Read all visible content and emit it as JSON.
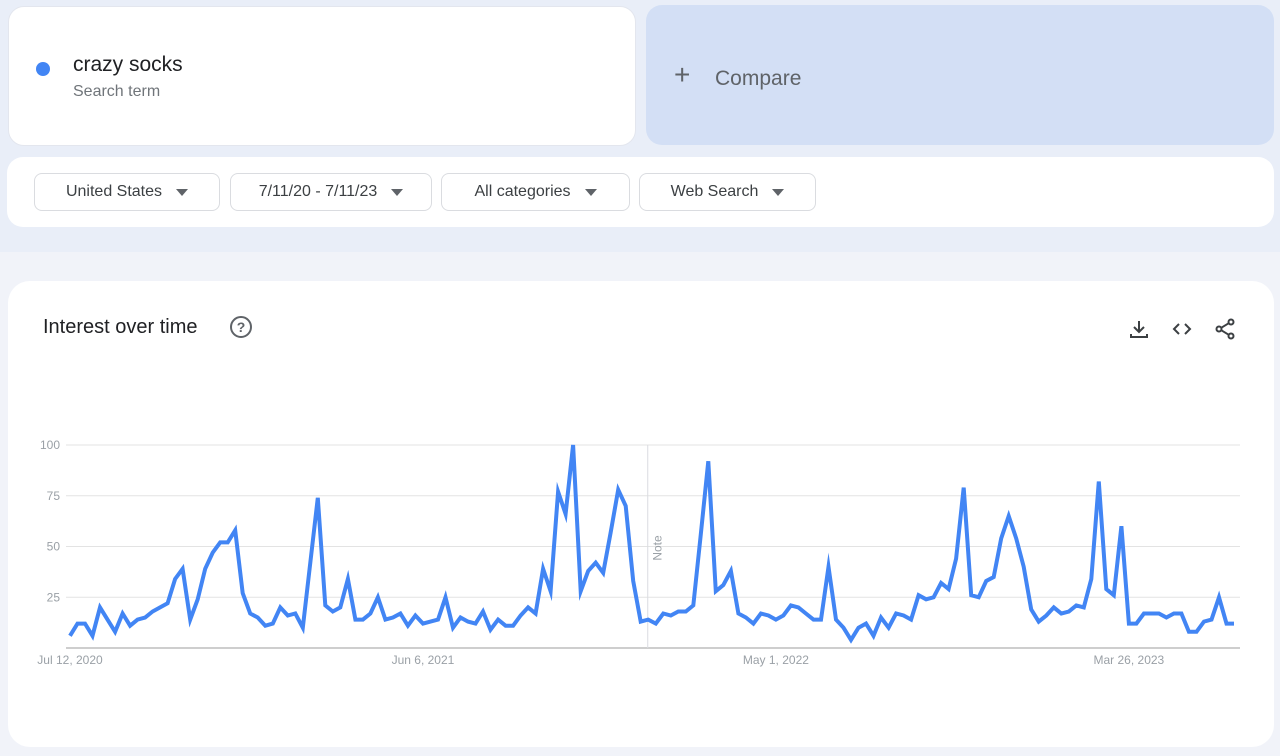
{
  "search_term": {
    "name": "crazy socks",
    "subtitle": "Search term",
    "color": "#4285f4"
  },
  "compare": {
    "icon": "plus-icon",
    "label": "Compare"
  },
  "filters": [
    {
      "label": "United States"
    },
    {
      "label": "7/11/20 - 7/11/23"
    },
    {
      "label": "All categories"
    },
    {
      "label": "Web Search"
    }
  ],
  "chart_card": {
    "title": "Interest over time",
    "help_icon": "help-circle-icon",
    "tools": [
      "download-icon",
      "embed-code-icon",
      "share-icon"
    ],
    "note_label": "Note"
  },
  "chart_data": {
    "type": "line",
    "title": "Interest over time",
    "xlabel": "",
    "ylabel": "",
    "ylim": [
      0,
      100
    ],
    "yticks": [
      25,
      50,
      75,
      100
    ],
    "grid": true,
    "x_tick_labels": [
      "Jul 12, 2020",
      "Jun 6, 2021",
      "May 1, 2022",
      "Mar 26, 2023"
    ],
    "x_tick_indices": [
      0,
      47,
      94,
      141
    ],
    "note_index": 77,
    "series": [
      {
        "name": "crazy socks",
        "color": "#4285f4",
        "values": [
          6,
          12,
          12,
          6,
          20,
          14,
          8,
          17,
          11,
          14,
          15,
          18,
          20,
          22,
          34,
          39,
          14,
          24,
          39,
          47,
          52,
          52,
          58,
          27,
          17,
          15,
          11,
          12,
          20,
          16,
          17,
          10,
          42,
          74,
          21,
          18,
          20,
          34,
          14,
          14,
          17,
          25,
          14,
          15,
          17,
          11,
          16,
          12,
          13,
          14,
          25,
          10,
          15,
          13,
          12,
          18,
          9,
          14,
          11,
          11,
          16,
          20,
          17,
          39,
          28,
          77,
          66,
          100,
          28,
          38,
          42,
          37,
          57,
          78,
          70,
          33,
          13,
          14,
          12,
          17,
          16,
          18,
          18,
          21,
          56,
          92,
          28,
          31,
          38,
          17,
          15,
          12,
          17,
          16,
          14,
          16,
          21,
          20,
          17,
          14,
          14,
          40,
          14,
          10,
          4,
          10,
          12,
          6,
          15,
          10,
          17,
          16,
          14,
          26,
          24,
          25,
          32,
          29,
          44,
          79,
          26,
          25,
          33,
          35,
          54,
          65,
          54,
          40,
          19,
          13,
          16,
          20,
          17,
          18,
          21,
          20,
          34,
          82,
          29,
          26,
          60,
          12,
          12,
          17,
          17,
          17,
          15,
          17,
          17,
          8,
          8,
          13,
          14,
          25,
          12,
          12
        ]
      }
    ]
  }
}
